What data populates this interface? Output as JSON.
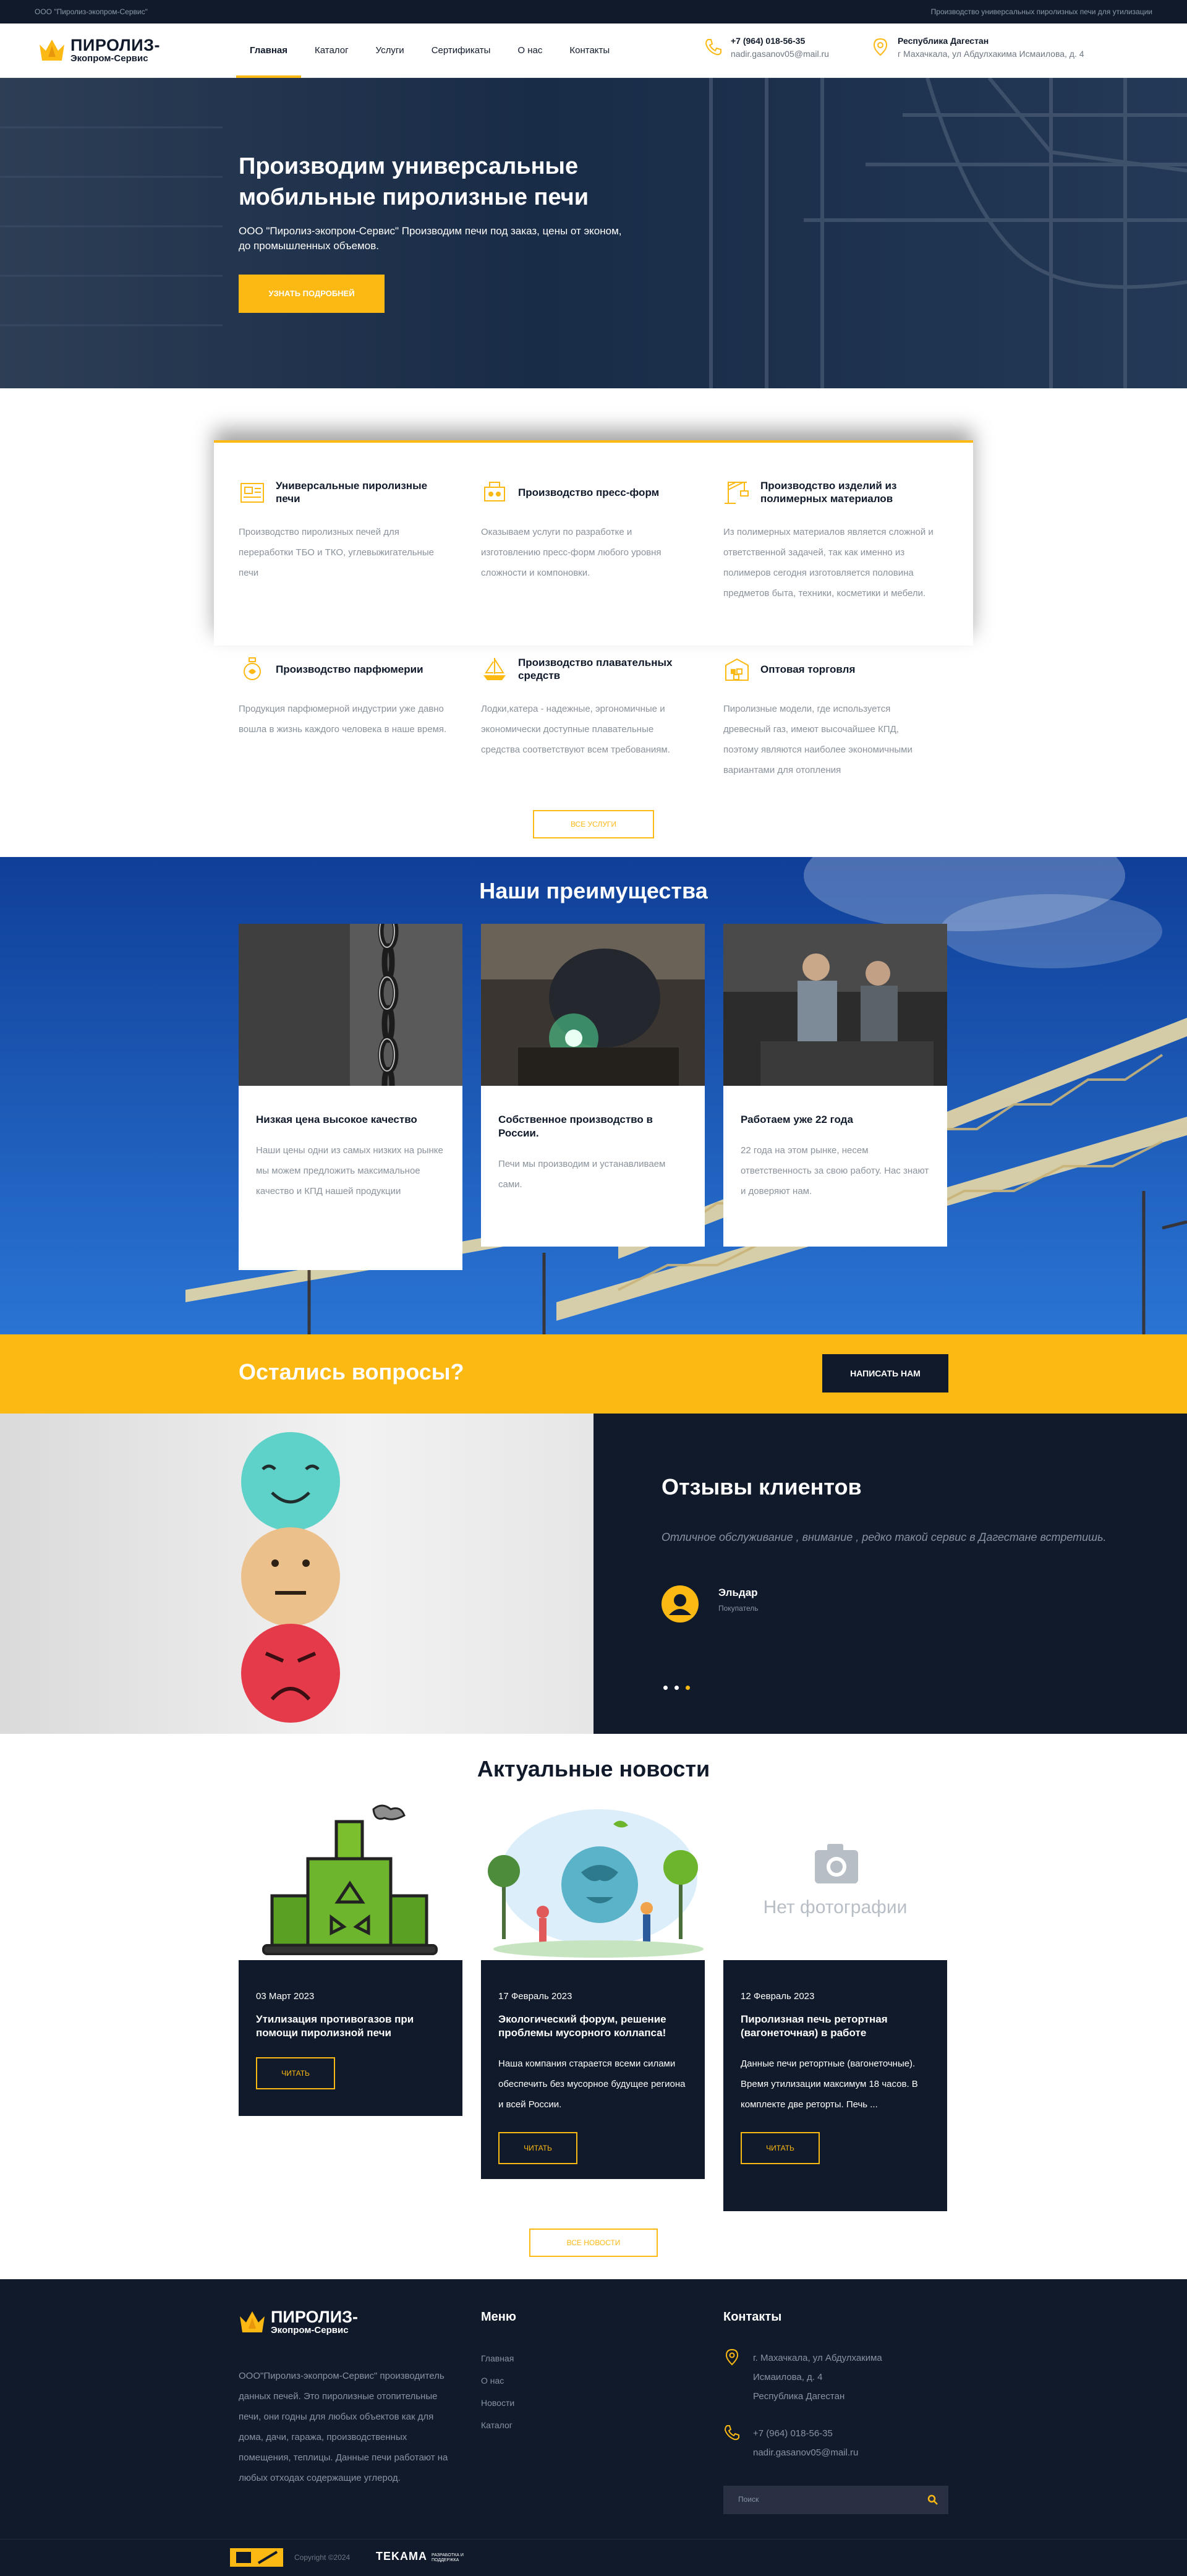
{
  "topbar": {
    "company": "ООО \"Пиролиз-экопром-Сервис\"",
    "tagline": "Производство универсальных пиролизных печи для утилизации"
  },
  "header": {
    "logo_line1": "ПИРОЛИЗ-",
    "logo_line2": "Экопром-Сервис",
    "nav": [
      "Главная",
      "Каталог",
      "Услуги",
      "Сертификаты",
      "О нас",
      "Контакты"
    ],
    "active_nav": "Главная",
    "phone": "+7 (964) 018-56-35",
    "email": "nadir.gasanov05@mail.ru",
    "region": "Республика Дагестан",
    "address": "г Махачкала, ул Абдулхакима Исмаилова, д. 4"
  },
  "hero": {
    "title": "Производим универсальные мобильные пиролизные печи",
    "subtitle": "ООО \"Пиролиз-экопром-Сервис\" Производим печи под заказ, цены от эконом, до промышленных объемов.",
    "button": "Узнать подробней"
  },
  "services": {
    "items": [
      {
        "title": "Универсальные пиролизные печи",
        "desc": "Производство пиролизных печей для переработки ТБО и ТКО, углевыжигательные печи",
        "icon": "furnace-icon"
      },
      {
        "title": "Производство пресс-форм",
        "desc": "Оказываем услуги по разработке и изготовлению пресс-форм любого уровня сложности и компоновки.",
        "icon": "press-mold-icon"
      },
      {
        "title": "Производство изделий из полимерных материалов",
        "desc": "Из полимерных материалов является сложной и ответственной задачей, так как именно из полимеров сегодня изготовляется половина предметов быта, техники, косметики и мебели.",
        "icon": "crane-icon"
      },
      {
        "title": "Производство парфюмерии",
        "desc": "Продукция парфюмерной индустрии уже давно вошла в жизнь каждого человека в наше время.",
        "icon": "perfume-icon"
      },
      {
        "title": "Производство плавательных средств",
        "desc": "Лодки,катера - надежные, эргономичные и экономически доступные плавательные средства соответствуют всем требованиям.",
        "icon": "boat-icon"
      },
      {
        "title": "Оптовая торговля",
        "desc": "Пиролизные модели, где используется древесный газ, имеют высочайшее КПД, поэтому являются наиболее экономичными вариантами для отопления",
        "icon": "warehouse-icon"
      }
    ],
    "all_button": "Все услуги"
  },
  "advantages": {
    "title": "Наши преимущества",
    "items": [
      {
        "title": "Низкая цена высокое качество",
        "desc": "Наши цены одни из самых низких на рынке мы можем предложить максимальное качество и КПД нашей продукции"
      },
      {
        "title": "Собственное производство в России.",
        "desc": "Печи мы производим и устанавливаем сами."
      },
      {
        "title": "Работаем уже 22 года",
        "desc": "22 года на этом рынке, несем ответственность за свою работу. Нас знают и доверяют нам."
      }
    ]
  },
  "cta": {
    "question": "Остались вопросы?",
    "button": "Написать нам"
  },
  "reviews": {
    "title": "Отзывы клиентов",
    "quote": "Отличное обслуживание , внимание , редко такой сервис в Дагестане встретишь.",
    "name": "Эльдар",
    "role": "Покупатель",
    "active_dot": 3
  },
  "news": {
    "title": "Актуальные новости",
    "items": [
      {
        "date": "03 Март 2023",
        "title": "Утилизация противогазов при помощи пиролизной печи",
        "desc": "",
        "button": "Читать"
      },
      {
        "date": "17 Февраль 2023",
        "title": "Экологический форум, решение проблемы мусорного коллапса!",
        "desc": "Наша компания старается всеми силами обеспечить без мусорное будущее региона и всей России.",
        "button": "Читать"
      },
      {
        "date": "12 Февраль 2023",
        "title": "Пиролизная печь ретортная (вагонеточная) в работе",
        "desc": "Данные печи ретортные (вагонеточные). Время утилизации максимум 18 часов. В комплекте две реторты. Печь ...",
        "button": "Читать",
        "no_photo": "Нет фотографии"
      }
    ],
    "all_button": "Все новости"
  },
  "footer": {
    "logo_line1": "ПИРОЛИЗ-",
    "logo_line2": "Экопром-Сервис",
    "about": "ООО\"Пиролиз-экопром-Сервис\" производитель данных печей. Это пиролизные отопительные печи, они годны для любых объектов как для дома, дачи, гаража, производственных помещения, теплицы. Данные печи работают на любых отходах содержащие углерод.",
    "menu_title": "Меню",
    "menu": [
      "Главная",
      "О нас",
      "Новости",
      "Каталог"
    ],
    "contacts_title": "Контакты",
    "address_lines": [
      "г. Махачкала, ул Абдулхакима",
      "Исмаилова, д. 4",
      "Республика Дагестан"
    ],
    "phone": "+7 (964) 018-56-35",
    "email": "nadir.gasanov05@mail.ru",
    "search_placeholder": "Поиск",
    "copyright": "Copyright ©2024",
    "dev_logo": "TEKAMA",
    "dev_tag": "РАЗРАБОТКА И ПОДДЕРЖКА"
  },
  "colors": {
    "accent": "#fdb913",
    "dark": "#101a2a",
    "advantages_bg": "#1a4aa8"
  }
}
